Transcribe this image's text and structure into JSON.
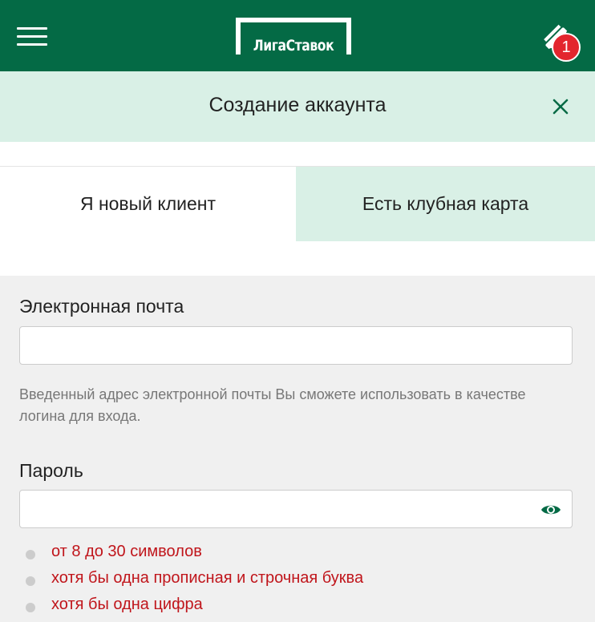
{
  "header": {
    "logo_text": "ЛигаСтавок",
    "coupon_count": "1"
  },
  "modal": {
    "title": "Создание аккаунта"
  },
  "tabs": [
    {
      "label": "Я новый клиент",
      "active": true
    },
    {
      "label": "Есть клубная карта",
      "active": false
    }
  ],
  "form": {
    "email": {
      "label": "Электронная почта",
      "value": "",
      "hint": "Введенный адрес электронной почты Вы сможете использовать в качестве логина для входа."
    },
    "password": {
      "label": "Пароль",
      "value": ""
    },
    "requirements": [
      "от 8 до 30 символов",
      "хотя бы одна прописная и строчная буква",
      "хотя бы одна цифра"
    ]
  },
  "colors": {
    "brand": "#046a45",
    "accent_light": "#d9f0e6",
    "badge": "#e3262e",
    "error": "#c0151b"
  }
}
